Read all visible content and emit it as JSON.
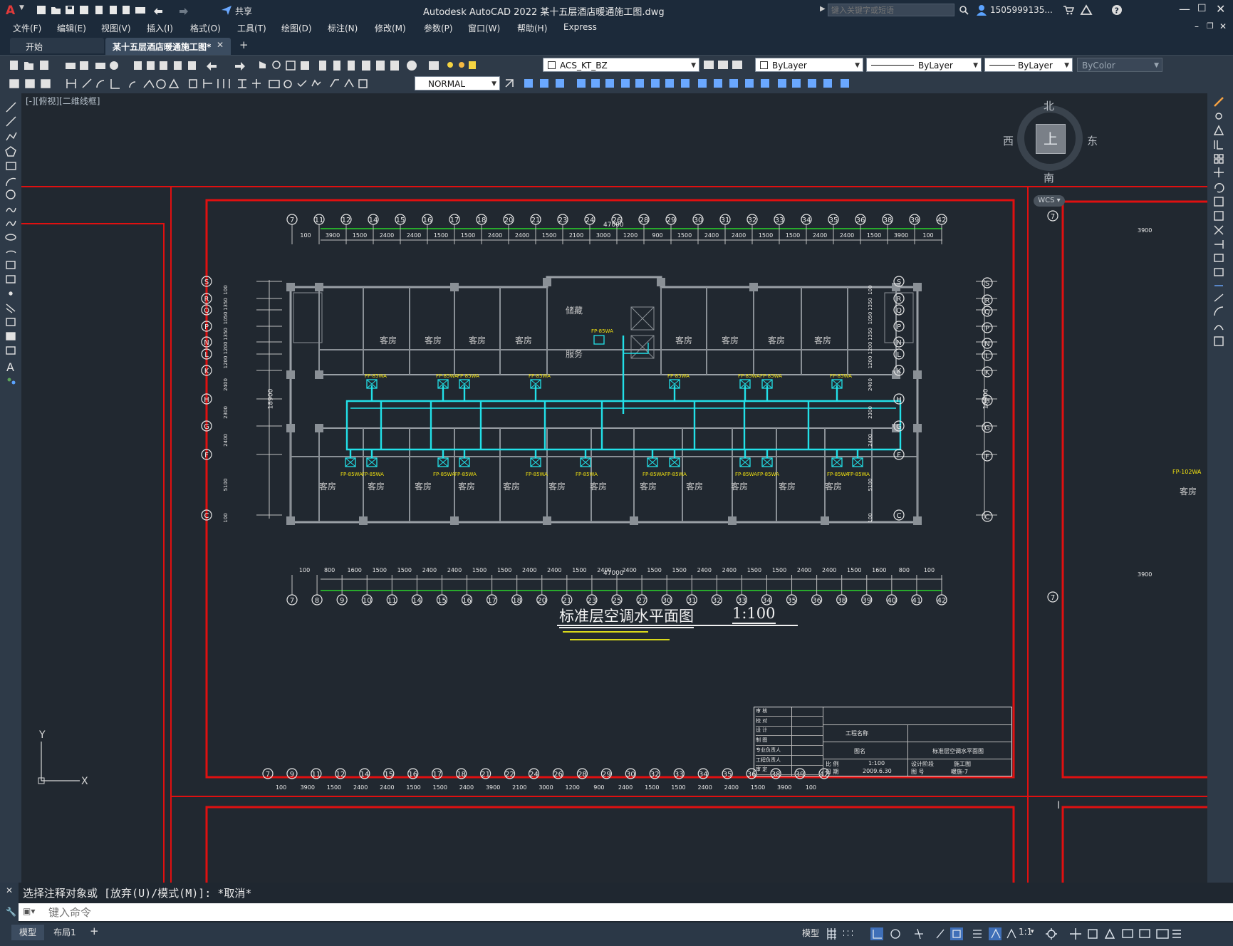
{
  "app": {
    "title": "Autodesk AutoCAD 2022    某十五层酒店暖通施工图.dwg",
    "share_label": "共享",
    "search_placeholder": "键入关键字或短语",
    "user_label": "1505999135...",
    "brand_color": "#e03a3a"
  },
  "menu": [
    "文件(F)",
    "编辑(E)",
    "视图(V)",
    "插入(I)",
    "格式(O)",
    "工具(T)",
    "绘图(D)",
    "标注(N)",
    "修改(M)",
    "参数(P)",
    "窗口(W)",
    "帮助(H)",
    "Express"
  ],
  "tabs": [
    {
      "label": "开始",
      "active": false
    },
    {
      "label": "某十五层酒店暖通施工图*",
      "active": true
    }
  ],
  "toolbar": {
    "layer_value": "ACS_KT_BZ",
    "color_value": "ByLayer",
    "linetype_value": "ByLayer",
    "lineweight_value": "ByLayer",
    "plotstyle_value": "ByColor",
    "dimstyle_value": "NORMAL"
  },
  "viewport": {
    "label": "[-][俯视][二维线框]"
  },
  "viewcube": {
    "north": "北",
    "south": "南",
    "east": "东",
    "west": "西",
    "top": "上",
    "wcs": "WCS"
  },
  "drawing": {
    "title": "标准层空调水平面图",
    "scale": "1:100",
    "total_width": "47000",
    "total_depth": "18900",
    "rooms_top": [
      "客房",
      "客房",
      "客房",
      "客房",
      "客房",
      "客房",
      "客房",
      "客房"
    ],
    "rooms_bottom": [
      "客房",
      "客房",
      "客房",
      "客房",
      "客房",
      "客房",
      "客房",
      "客房",
      "客房",
      "客房",
      "客房",
      "客房"
    ],
    "room_storage": "储藏",
    "room_service": "服务",
    "fan_coil_label": "FP-85WA",
    "axes_top": [
      "7",
      "11",
      "12",
      "14",
      "15",
      "16",
      "17",
      "18",
      "20",
      "21",
      "23",
      "24",
      "26",
      "28",
      "29",
      "30",
      "31",
      "32",
      "33",
      "34",
      "35",
      "36",
      "38",
      "39",
      "42"
    ],
    "axes_bottom": [
      "7",
      "8",
      "9",
      "10",
      "11",
      "14",
      "15",
      "16",
      "17",
      "18",
      "20",
      "21",
      "23",
      "25",
      "27",
      "30",
      "31",
      "32",
      "33",
      "34",
      "35",
      "36",
      "38",
      "39",
      "40",
      "41",
      "42"
    ],
    "axes_side": [
      "S",
      "R",
      "Q",
      "P",
      "N",
      "L",
      "K",
      "H",
      "G",
      "F",
      "C"
    ],
    "dims_top": [
      "100",
      "3900",
      "1500",
      "2400",
      "2400",
      "1500",
      "1500",
      "2400",
      "2400",
      "1500",
      "2100",
      "3000",
      "1200",
      "900",
      "1500",
      "2400",
      "2400",
      "1500",
      "1500",
      "2400",
      "2400",
      "1500",
      "3900",
      "100"
    ],
    "dims_bottom": [
      "100",
      "800",
      "1600",
      "1500",
      "1500",
      "2400",
      "2400",
      "1500",
      "1500",
      "2400",
      "2400",
      "1500",
      "2400",
      "2400",
      "1500",
      "1500",
      "2400",
      "2400",
      "1500",
      "1500",
      "2400",
      "2400",
      "1500",
      "1600",
      "800",
      "100"
    ],
    "dims_side": [
      "100",
      "1350",
      "1050",
      "1350",
      "1200",
      "1200",
      "2400",
      "2300",
      "2400",
      "5100",
      "100"
    ],
    "next_dims": [
      "100",
      "3900",
      "1500",
      "2400",
      "2400",
      "1500",
      "1500",
      "2400",
      "3900",
      "2100",
      "3000",
      "1200",
      "900",
      "2400",
      "1500",
      "1500",
      "2400",
      "2400",
      "1500",
      "3900",
      "100"
    ],
    "next_axes": [
      "7",
      "9",
      "11",
      "12",
      "14",
      "15",
      "16",
      "17",
      "18",
      "21",
      "22",
      "24",
      "26",
      "28",
      "29",
      "30",
      "32",
      "33",
      "34",
      "35",
      "36",
      "38",
      "39",
      "42"
    ],
    "right_axes": [
      "S",
      "R",
      "Q",
      "P",
      "N",
      "L",
      "K",
      "H",
      "G",
      "F",
      "C"
    ],
    "right_dims": [
      "3900"
    ],
    "right_fan_label": "FP-102WA",
    "title_block": {
      "project_label": "工程名称",
      "item_label": "图名",
      "drawing_name": "标准层空调水平面图",
      "scale_label": "比 例",
      "scale_value": "1:100",
      "date_label": "日 期",
      "date_value": "2009.6.30",
      "stage_label": "设计阶段",
      "stage_value": "施工图",
      "number_label": "图 号",
      "number_value": "暖施-7",
      "rows": [
        "审 核",
        "校 对",
        "设 计",
        "制 图",
        "专业负责人",
        "工程负责人",
        "审 定"
      ]
    }
  },
  "command": {
    "history": "选择注释对象或 [放弃(U)/模式(M)]: *取消*",
    "placeholder": "键入命令"
  },
  "status": {
    "tab_model": "模型",
    "tab_layout": "布局1",
    "model_label": "模型",
    "scale_label": "1:1"
  }
}
